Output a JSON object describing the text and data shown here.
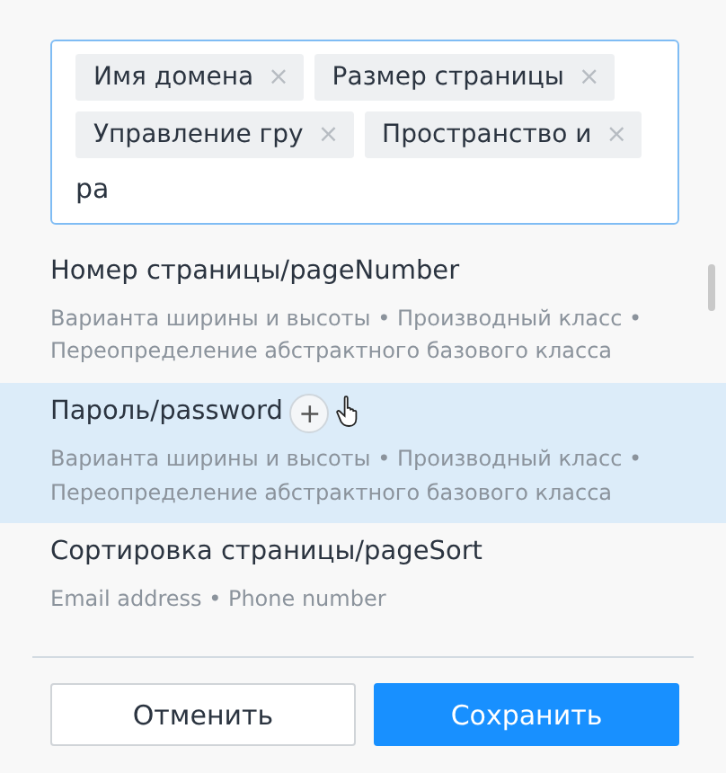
{
  "field": {
    "tags": [
      {
        "label": "Имя домена",
        "remove": "×"
      },
      {
        "label": "Размер страницы",
        "remove": "×"
      },
      {
        "label": "Управление гру",
        "remove": "×"
      },
      {
        "label": "Пространство и",
        "remove": "×"
      }
    ],
    "value": "pa"
  },
  "options": [
    {
      "title": "Номер страницы/pageNumber",
      "description": "Варианта ширины и высоты • Производный класс • Переопределение абстрактного базового класса",
      "highlighted": false
    },
    {
      "title": "Пароль/password",
      "description": "Варианта ширины и высоты • Производный класс • Переопределение абстрактного базового класса",
      "highlighted": true,
      "add_button": "+"
    },
    {
      "title": "Сортировка страницы/pageSort",
      "description": "Email address • Phone number",
      "highlighted": false
    }
  ],
  "buttons": [
    {
      "label": "Отменить",
      "kind": "secondary"
    },
    {
      "label": "Сохранить",
      "kind": "primary"
    }
  ]
}
